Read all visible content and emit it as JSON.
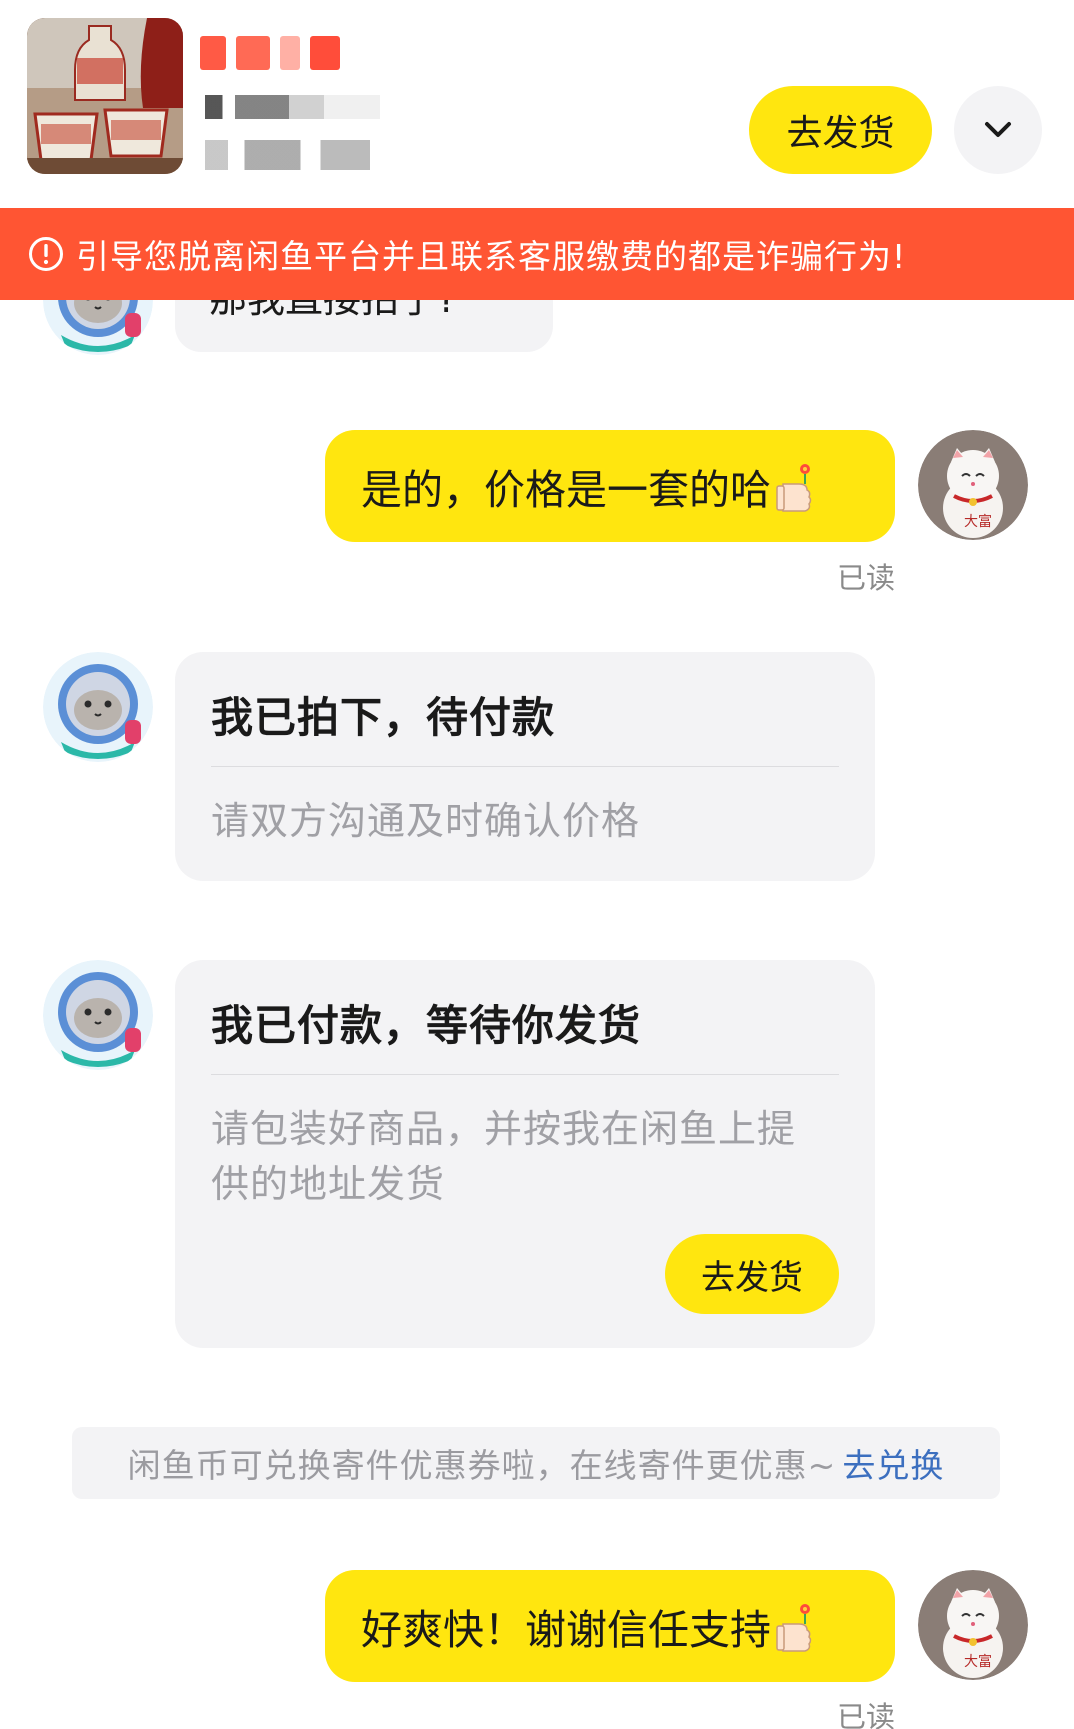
{
  "header": {
    "ship_button_label": "去发货",
    "expand_icon": "chevron-down-icon"
  },
  "warning": {
    "icon": "exclamation-circle-icon",
    "text": "引导您脱离闲鱼平台并且联系客服缴费的都是诈骗行为!"
  },
  "messages": [
    {
      "type": "incoming-text",
      "text": "那我直接拍了?"
    },
    {
      "type": "outgoing-text",
      "text": "是的，价格是一套的哈",
      "emoji": "thumbs-up-flower-icon",
      "status": "已读"
    },
    {
      "type": "system-card",
      "title": "我已拍下，待付款",
      "subtitle": "请双方沟通及时确认价格"
    },
    {
      "type": "system-card",
      "title": "我已付款，等待你发货",
      "subtitle_line1": "请包装好商品，并按我在闲鱼上提",
      "subtitle_line2": "供的地址发货",
      "button_label": "去发货"
    },
    {
      "type": "tip",
      "text": "闲鱼币可兑换寄件优惠券啦，在线寄件更优惠~",
      "link": "去兑换"
    },
    {
      "type": "outgoing-text",
      "text": "好爽快！谢谢信任支持",
      "emoji": "thumbs-up-flower-icon",
      "status": "已读"
    }
  ],
  "colors": {
    "accent_yellow": "#ffe60f",
    "warning_red": "#ff5533",
    "bubble_gray": "#f3f3f5",
    "link_blue": "#3c6fbf"
  }
}
